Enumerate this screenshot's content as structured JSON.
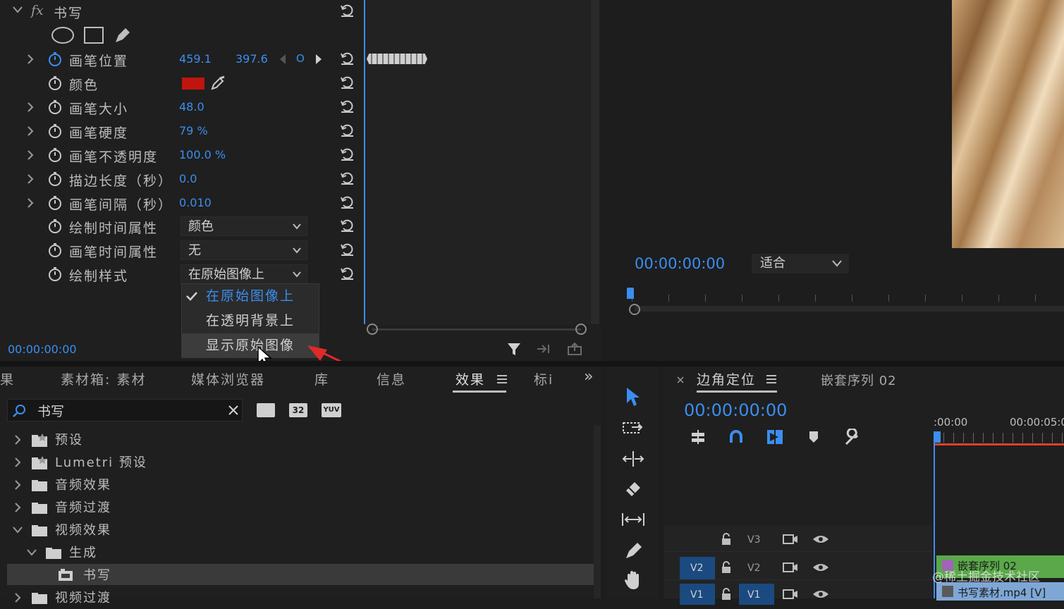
{
  "effect_controls": {
    "effect_name": "书写",
    "fx_label": "fx",
    "properties": [
      {
        "label": "画笔位置",
        "value": "459.1",
        "value2": "397.6",
        "keyframe_nav": "O",
        "expandable": true,
        "animated": true
      },
      {
        "label": "颜色",
        "value": "",
        "swatch": "#c0140e",
        "expandable": false
      },
      {
        "label": "画笔大小",
        "value": "48.0",
        "expandable": true
      },
      {
        "label": "画笔硬度",
        "value": "79 %",
        "expandable": true
      },
      {
        "label": "画笔不透明度",
        "value": "100.0 %",
        "expandable": true
      },
      {
        "label": "描边长度（秒）",
        "value": "0.0",
        "expandable": true
      },
      {
        "label": "画笔间隔（秒）",
        "value": "0.010",
        "expandable": true
      },
      {
        "label": "绘制时间属性",
        "dropdown": "颜色"
      },
      {
        "label": "画笔时间属性",
        "dropdown": "无"
      },
      {
        "label": "绘制样式",
        "dropdown": "在原始图像上"
      }
    ],
    "timecode": "00:00:00:00"
  },
  "style_menu": {
    "items": [
      "在原始图像上",
      "在透明背景上",
      "显示原始图像"
    ],
    "selected": "在原始图像上",
    "hovered": "显示原始图像"
  },
  "program_monitor": {
    "timecode": "00:00:00:00",
    "fit_label": "适合"
  },
  "project_panel": {
    "tabs": [
      "果",
      "素材箱: 素材",
      "媒体浏览器",
      "库",
      "信息",
      "效果",
      "标i"
    ],
    "active_tab": "效果",
    "overflow": "»",
    "search_value": "书写",
    "tree": [
      {
        "label": "预设",
        "expanded": false,
        "indent": 0,
        "kind": "preset"
      },
      {
        "label": "Lumetri 预设",
        "expanded": false,
        "indent": 0,
        "kind": "preset"
      },
      {
        "label": "音频效果",
        "expanded": false,
        "indent": 0,
        "kind": "folder"
      },
      {
        "label": "音频过渡",
        "expanded": false,
        "indent": 0,
        "kind": "folder"
      },
      {
        "label": "视频效果",
        "expanded": true,
        "indent": 0,
        "kind": "folder"
      },
      {
        "label": "生成",
        "expanded": true,
        "indent": 1,
        "kind": "folder"
      },
      {
        "label": "书写",
        "expanded": false,
        "indent": 2,
        "kind": "effect"
      },
      {
        "label": "视频过渡",
        "expanded": false,
        "indent": 0,
        "kind": "folder"
      }
    ],
    "filter_badges": [
      "32",
      "YUV"
    ]
  },
  "timeline": {
    "tab_active": "边角定位",
    "tab_other": "嵌套序列 02",
    "timecode": "00:00:00:00",
    "ruler_labels": [
      ":00:00",
      "00:00:05:0"
    ],
    "tracks": [
      "V3",
      "V2",
      "V1"
    ],
    "clip_top": "嵌套序列 02",
    "clip_bottom": "书写素材.mp4 [V]",
    "watermark": "@稀土掘金技术社区",
    "playhead_color": "#3b8ef0",
    "work_area_color": "#e0402a"
  },
  "colors": {
    "accent": "#3b8ef0",
    "arrow": "#e02a2a"
  }
}
